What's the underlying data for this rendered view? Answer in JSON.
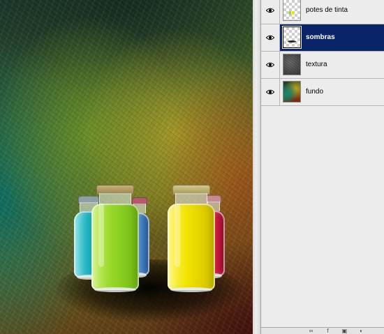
{
  "layers_panel": {
    "layers": [
      {
        "name": "potes de tinta",
        "visible": true,
        "selected": false,
        "thumbnail": "transparent-with-bottles"
      },
      {
        "name": "sombras",
        "visible": true,
        "selected": true,
        "thumbnail": "transparent-with-shadow"
      },
      {
        "name": "textura",
        "visible": true,
        "selected": false,
        "thumbnail": "grey-texture"
      },
      {
        "name": "fundo",
        "visible": true,
        "selected": false,
        "thumbnail": "colorful-gradient"
      }
    ],
    "icons": {
      "visibility": "eye-icon",
      "footer": [
        "link-layers-icon",
        "layer-style-icon",
        "add-mask-icon",
        "adjustment-layer-icon"
      ]
    },
    "colors": {
      "selected_row": "#0a246a",
      "panel_bg": "#ececec"
    }
  },
  "canvas": {
    "bottles": [
      {
        "color": "cyan",
        "hex": "#1fb3c2"
      },
      {
        "color": "green",
        "hex": "#9ad92a"
      },
      {
        "color": "blue",
        "hex": "#4a8ad0"
      },
      {
        "color": "yellow",
        "hex": "#f2e400"
      },
      {
        "color": "red",
        "hex": "#e0204a"
      }
    ]
  }
}
